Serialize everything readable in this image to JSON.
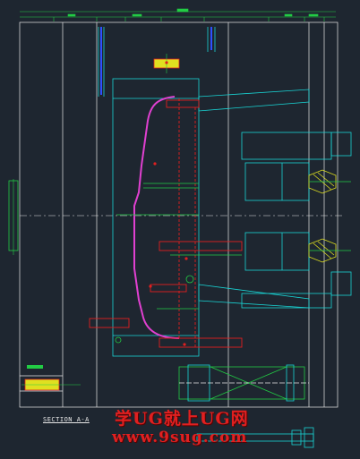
{
  "section_label": "SECTION A-A",
  "watermark": {
    "title": "学UG就上UG网",
    "url": "www.9sug.com"
  },
  "colors": {
    "background": "#1e2630",
    "outline": "#e8e8e8",
    "cyan": "#19d4d4",
    "green": "#22cc44",
    "magenta": "#e040d0",
    "red": "#e02020",
    "yellow": "#e0e020",
    "blue": "#3050ff"
  }
}
